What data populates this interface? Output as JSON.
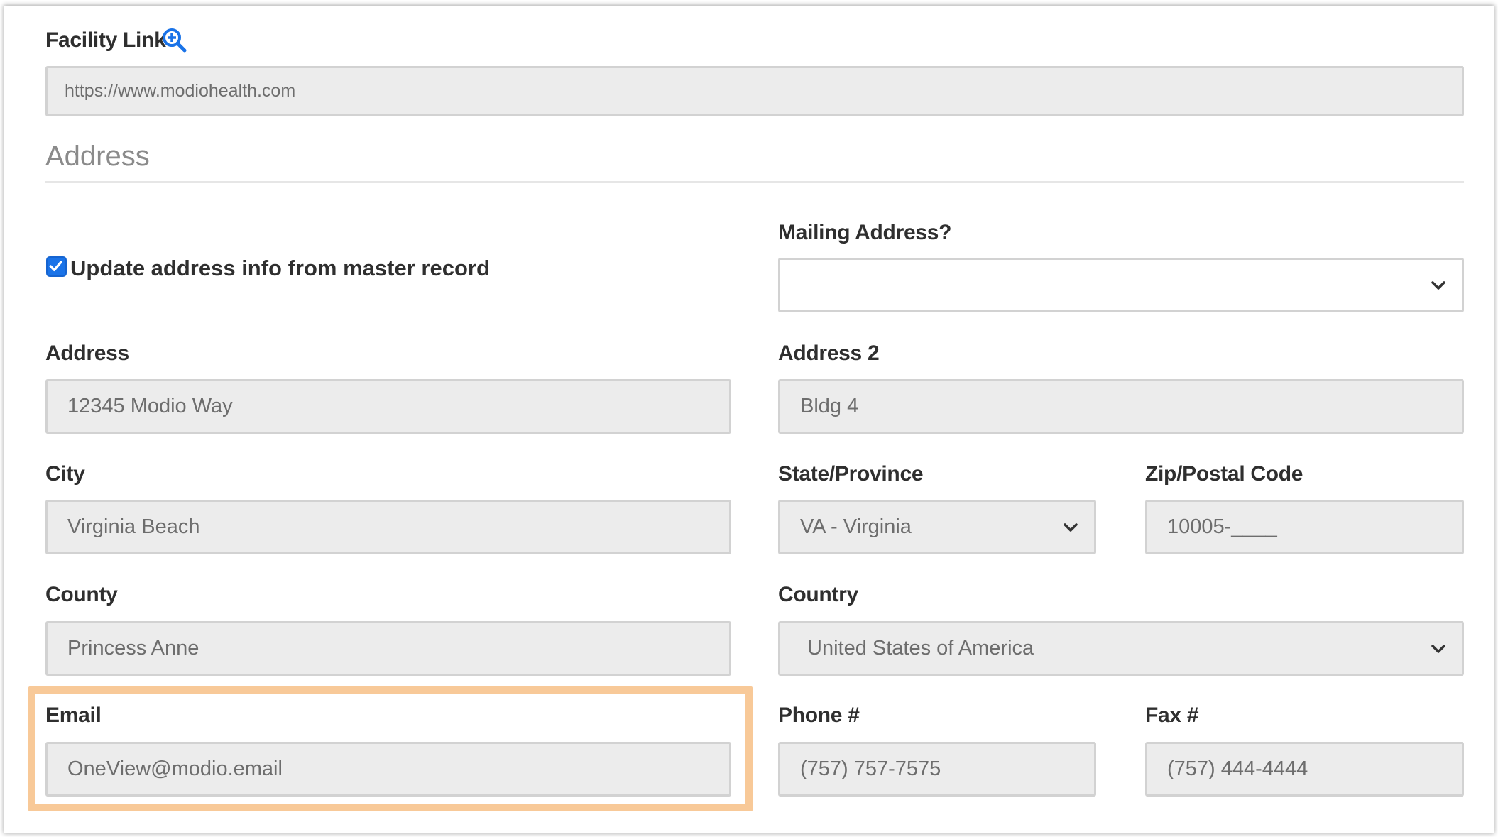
{
  "facility_link": {
    "label": "Facility Link",
    "value": "https://www.modiohealth.com"
  },
  "section_title": "Address",
  "update_checkbox": {
    "label": "Update address info from master record",
    "checked": true,
    "color": "#1a73e8"
  },
  "mailing_address": {
    "label": "Mailing Address?",
    "value": ""
  },
  "address": {
    "label": "Address",
    "value": "12345 Modio Way"
  },
  "address2": {
    "label": "Address 2",
    "value": "Bldg 4"
  },
  "city": {
    "label": "City",
    "value": "Virginia Beach"
  },
  "state": {
    "label": "State/Province",
    "value": "VA - Virginia"
  },
  "zip": {
    "label": "Zip/Postal Code",
    "value": "10005-____"
  },
  "county": {
    "label": "County",
    "value": "Princess Anne"
  },
  "country": {
    "label": "Country",
    "value": "United States of America"
  },
  "email": {
    "label": "Email",
    "value": "OneView@modio.email",
    "highlight_color": "#f8c998"
  },
  "phone": {
    "label": "Phone #",
    "value": "(757) 757-7575"
  },
  "fax": {
    "label": "Fax #",
    "value": "(757) 444-4444"
  },
  "icons": {
    "facility_link_icon": "zoom-in-icon",
    "select_icon": "chevron-down-icon"
  },
  "accent_color": "#1a73e8"
}
